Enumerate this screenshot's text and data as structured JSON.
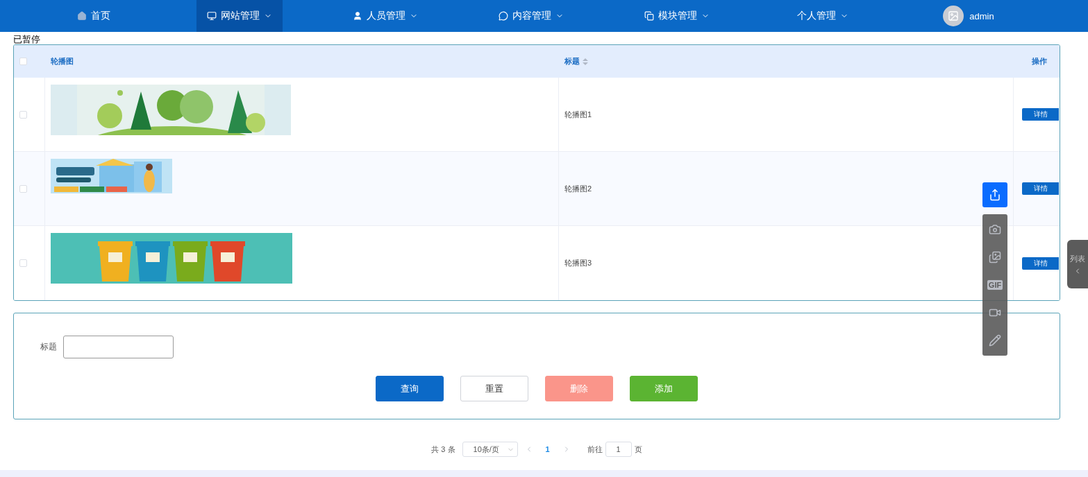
{
  "pause_label": "已暂停",
  "nav": {
    "items": [
      {
        "label": "首页",
        "has_menu": false,
        "selected": false
      },
      {
        "label": "网站管理",
        "has_menu": true,
        "selected": true
      },
      {
        "label": "人员管理",
        "has_menu": true,
        "selected": false
      },
      {
        "label": "内容管理",
        "has_menu": true,
        "selected": false
      },
      {
        "label": "模块管理",
        "has_menu": true,
        "selected": false
      },
      {
        "label": "个人管理",
        "has_menu": true,
        "selected": false
      }
    ],
    "user": {
      "name": "admin"
    }
  },
  "table": {
    "select_all": {
      "checked": false
    },
    "columns": [
      {
        "label": "轮播图",
        "sortable": false
      },
      {
        "label": "标题",
        "sortable": true
      },
      {
        "label": "操作",
        "sortable": false
      }
    ],
    "rows": [
      {
        "checked": false,
        "title": "轮播图1",
        "action": "详情"
      },
      {
        "checked": false,
        "title": "轮播图2",
        "action": "详情"
      },
      {
        "checked": false,
        "title": "轮播图3",
        "action": "详情"
      }
    ]
  },
  "search_form": {
    "fields": [
      {
        "label": "标题"
      }
    ],
    "buttons": [
      {
        "label": "查询",
        "kind": "primary"
      },
      {
        "label": "重置",
        "kind": "default"
      },
      {
        "label": "删除",
        "kind": "danger"
      },
      {
        "label": "添加",
        "kind": "success"
      }
    ]
  },
  "pagination": {
    "total": "共 3 条",
    "page_size": "10条/页",
    "pages": [
      {
        "label": "1",
        "selected": true
      }
    ],
    "goto_label": "前往",
    "goto_value": "1",
    "page_unit": "页"
  },
  "capture_toolbar": {
    "tools": [
      {
        "kind": "share",
        "selected": true
      },
      {
        "kind": "camera",
        "selected": false
      },
      {
        "kind": "gallery",
        "selected": false
      },
      {
        "kind": "gif",
        "label": "GIF",
        "selected": false
      },
      {
        "kind": "video",
        "selected": false
      },
      {
        "kind": "pen",
        "selected": false
      }
    ]
  },
  "side_tab": {
    "label": "列表"
  }
}
